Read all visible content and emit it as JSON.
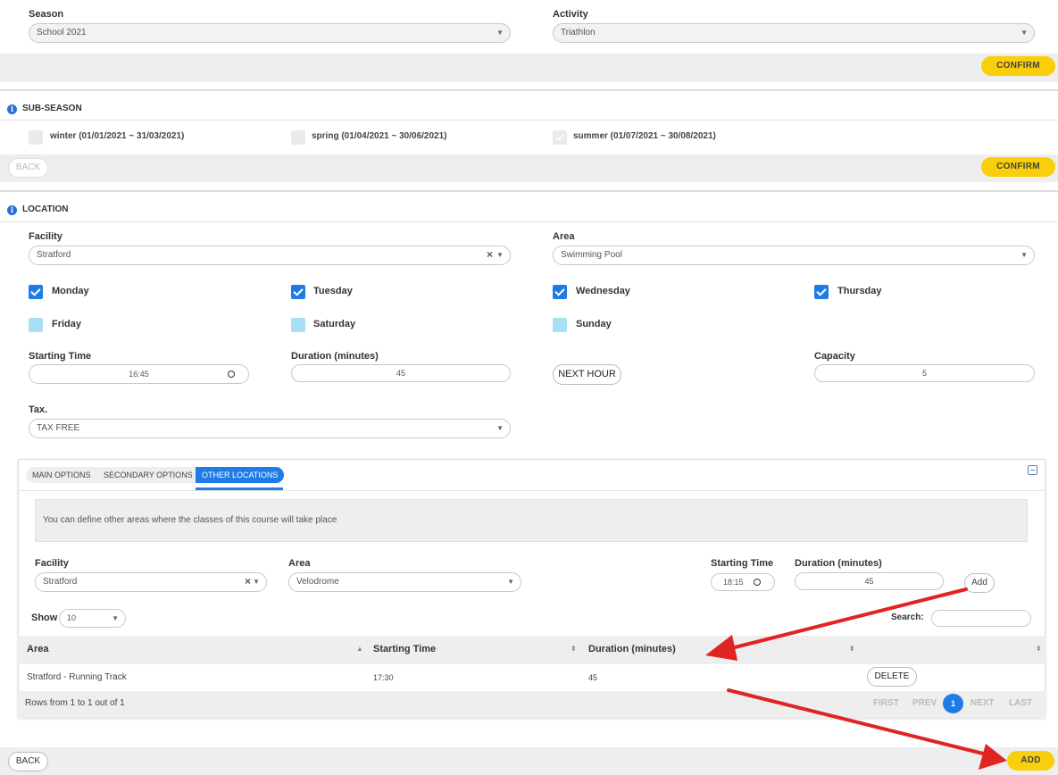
{
  "top": {
    "season_label": "Season",
    "season_value": "School 2021",
    "activity_label": "Activity",
    "activity_value": "Triathlon",
    "confirm_label": "CONFIRM"
  },
  "subseason": {
    "title": "SUB-SEASON",
    "options": [
      {
        "label": "winter (01/01/2021 ~ 31/03/2021)",
        "checked": false
      },
      {
        "label": "spring (01/04/2021 ~ 30/06/2021)",
        "checked": false
      },
      {
        "label": "summer (01/07/2021 ~ 30/08/2021)",
        "checked": true
      }
    ],
    "back_label": "BACK",
    "confirm_label": "CONFIRM"
  },
  "location": {
    "title": "LOCATION",
    "facility_label": "Facility",
    "facility_value": "Stratford",
    "area_label": "Area",
    "area_value": "Swimming Pool",
    "days": [
      {
        "label": "Monday",
        "checked": true
      },
      {
        "label": "Tuesday",
        "checked": true
      },
      {
        "label": "Wednesday",
        "checked": true
      },
      {
        "label": "Thursday",
        "checked": true
      },
      {
        "label": "Friday",
        "checked": false
      },
      {
        "label": "Saturday",
        "checked": false
      },
      {
        "label": "Sunday",
        "checked": false
      }
    ],
    "starting_time_label": "Starting Time",
    "starting_time_value": "16:45",
    "duration_label": "Duration (minutes)",
    "duration_value": "45",
    "next_hour_label": "NEXT HOUR",
    "capacity_label": "Capacity",
    "capacity_value": "5",
    "tax_label": "Tax.",
    "tax_value": "TAX FREE"
  },
  "options_panel": {
    "tabs": [
      {
        "label": "MAIN OPTIONS",
        "active": false
      },
      {
        "label": "SECONDARY OPTIONS",
        "active": false
      },
      {
        "label": "OTHER LOCATIONS",
        "active": true
      }
    ],
    "info_text": "You can define other areas where the classes of this course will take place",
    "facility_label": "Facility",
    "facility_value": "Stratford",
    "area_label": "Area",
    "area_value": "Velodrome",
    "starting_time_label": "Starting Time",
    "starting_time_value": "18:15",
    "duration_label": "Duration (minutes)",
    "duration_value": "45",
    "add_label": "Add",
    "show_label": "Show",
    "show_value": "10",
    "search_label": "Search:",
    "search_value": "",
    "columns": [
      "Area",
      "Starting Time",
      "Duration (minutes)"
    ],
    "rows": [
      {
        "area": "Stratford - Running Track",
        "starting_time": "17:30",
        "duration": "45",
        "action": "DELETE"
      }
    ],
    "rows_info": "Rows from 1 to 1 out of 1",
    "pagination": {
      "first": "FIRST",
      "prev": "PREV",
      "current": "1",
      "next": "NEXT",
      "last": "LAST"
    }
  },
  "footer": {
    "back_label": "BACK",
    "add_label": "ADD"
  },
  "colors": {
    "accent_yellow": "#f9cf0b",
    "checkbox_blue": "#1f7be6",
    "checkbox_unchecked": "#a8dff3",
    "annotation_red": "#e02424"
  }
}
